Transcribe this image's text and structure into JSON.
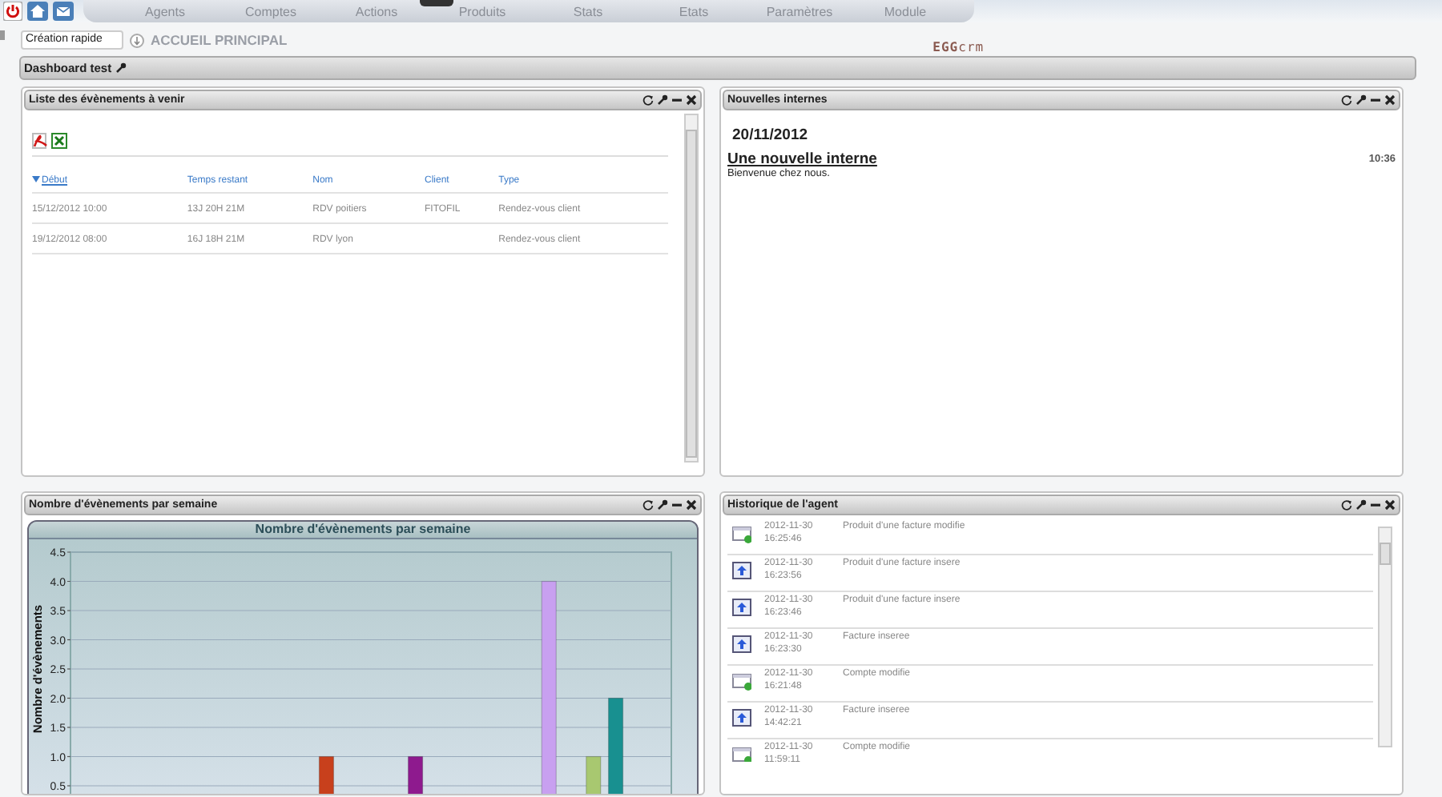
{
  "top_nav": {
    "tabs": [
      {
        "label": "Agents"
      },
      {
        "label": "Comptes"
      },
      {
        "label": "Actions"
      },
      {
        "label": "Produits"
      },
      {
        "label": "Stats"
      },
      {
        "label": "Etats"
      },
      {
        "label": "Paramètres"
      },
      {
        "label": "Module"
      }
    ]
  },
  "quick_bar": {
    "select_value": "Création rapide",
    "page_title": "ACCUEIL PRINCIPAL",
    "logo": "**EGG**crm"
  },
  "dashboard": {
    "title": "Dashboard test"
  },
  "panels": [
    {
      "kind": "events",
      "title": "Liste des évènements à venir",
      "columns": [
        "Début",
        "Temps restant",
        "Nom",
        "Client",
        "Type"
      ],
      "rows": [
        [
          "15/12/2012 10:00",
          "13J 20H 21M",
          "RDV poitiers",
          "FITOFIL",
          "Rendez-vous client"
        ],
        [
          "19/12/2012 08:00",
          "16J 18H 21M",
          "RDV lyon",
          "",
          "Rendez-vous client"
        ]
      ]
    },
    {
      "kind": "news",
      "title": "Nouvelles internes",
      "date": "20/11/2012",
      "headline": "Une nouvelle interne",
      "time": "10:36",
      "body": "Bienvenue chez nous."
    },
    {
      "kind": "chart",
      "title": "Nombre d'évènements par semaine",
      "chart_data": {
        "type": "bar",
        "title": "Nombre d'évènements par semaine",
        "ylabel": "Nombre d'évènements",
        "ylim": [
          0,
          4.5
        ],
        "yticks": [
          0.5,
          {
            "value": 1,
            "label": "1.0"
          },
          1.5,
          {
            "value": 2,
            "label": "2.0"
          },
          2.5,
          {
            "value": 3,
            "label": "3.0"
          },
          3.5,
          {
            "value": 4,
            "label": "4.0"
          },
          4.5
        ],
        "grid": true,
        "stacked": true,
        "series": [
          {
            "color": "#c8401c",
            "values": [
              null,
              null,
              null,
              null,
              null,
              null,
              null,
              null,
              null,
              null,
              null,
              1,
              null,
              null,
              null,
              null,
              null,
              null,
              null,
              null,
              null,
              null,
              null,
              null,
              null,
              null,
              null
            ]
          },
          {
            "color": "#8e1a8e",
            "values": [
              null,
              null,
              null,
              null,
              null,
              null,
              null,
              null,
              null,
              null,
              null,
              null,
              null,
              null,
              null,
              1,
              null,
              null,
              null,
              null,
              null,
              null,
              null,
              null,
              null,
              null,
              null
            ]
          },
          {
            "color": "#c8a0f0",
            "values": [
              null,
              null,
              null,
              null,
              null,
              null,
              null,
              null,
              null,
              null,
              null,
              null,
              null,
              null,
              null,
              null,
              null,
              null,
              null,
              null,
              null,
              4,
              null,
              null,
              null,
              null,
              null
            ]
          },
          {
            "color": "#a8c870",
            "values": [
              null,
              null,
              null,
              null,
              null,
              null,
              null,
              null,
              null,
              null,
              null,
              null,
              null,
              null,
              null,
              null,
              null,
              null,
              null,
              null,
              null,
              null,
              null,
              1,
              null,
              null,
              null
            ]
          },
          {
            "color": "#189090",
            "values": [
              null,
              null,
              null,
              null,
              null,
              null,
              null,
              null,
              null,
              null,
              null,
              null,
              null,
              null,
              null,
              null,
              null,
              null,
              null,
              null,
              null,
              null,
              null,
              null,
              2,
              null,
              null
            ]
          }
        ]
      }
    },
    {
      "kind": "history",
      "title": "Historique de l'agent",
      "entries": [
        {
          "kind": "modified",
          "date": "2012-11-30",
          "time": "16:25:46",
          "action": "Produit d'une facture modifie"
        },
        {
          "kind": "inserted",
          "date": "2012-11-30",
          "time": "16:23:56",
          "action": "Produit d'une facture insere"
        },
        {
          "kind": "inserted",
          "date": "2012-11-30",
          "time": "16:23:46",
          "action": "Produit d'une facture insere"
        },
        {
          "kind": "inserted",
          "date": "2012-11-30",
          "time": "16:23:30",
          "action": "Facture inseree"
        },
        {
          "kind": "modified",
          "date": "2012-11-30",
          "time": "16:21:48",
          "action": "Compte modifie"
        },
        {
          "kind": "inserted",
          "date": "2012-11-30",
          "time": "14:42:21",
          "action": "Facture inseree"
        },
        {
          "kind": "modified",
          "date": "2012-11-30",
          "time": "11:59:11",
          "action": "Compte modifie"
        }
      ]
    }
  ]
}
